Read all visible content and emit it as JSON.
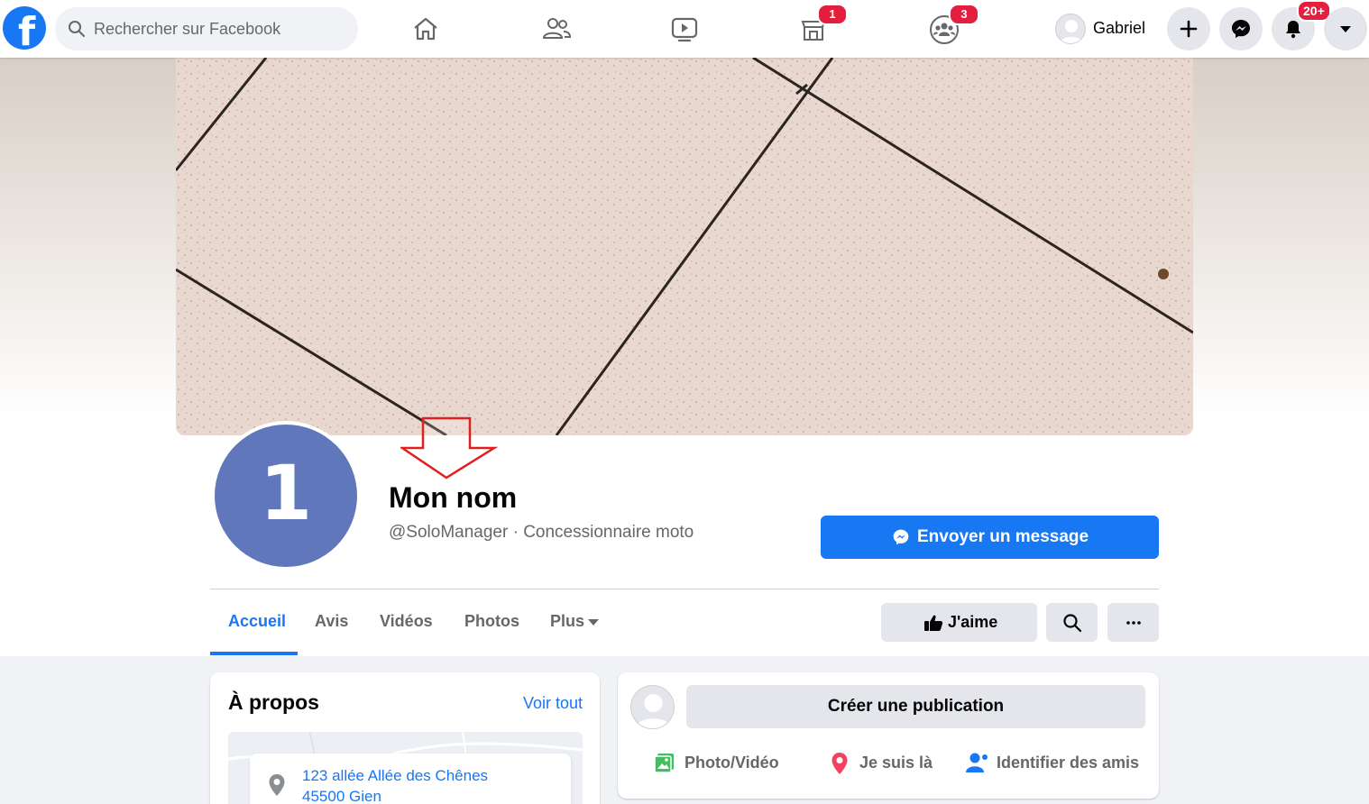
{
  "topbar": {
    "logo": "f",
    "search_placeholder": "Rechercher sur Facebook",
    "nav": [
      {
        "name": "home-icon"
      },
      {
        "name": "friends-icon"
      },
      {
        "name": "watch-icon"
      },
      {
        "name": "marketplace-icon",
        "badge": "1"
      },
      {
        "name": "groups-icon",
        "badge": "3"
      }
    ],
    "user_name": "Gabriel",
    "notifications_badge": "20+"
  },
  "page": {
    "avatar_text": "1",
    "title": "Mon nom",
    "subtitle": "@SoloManager · Concessionnaire moto",
    "message_button": "Envoyer un message"
  },
  "tabs": [
    {
      "label": "Accueil",
      "active": true
    },
    {
      "label": "Avis"
    },
    {
      "label": "Vidéos"
    },
    {
      "label": "Photos"
    },
    {
      "label": "Plus"
    }
  ],
  "actions": {
    "like_label": "J'aime"
  },
  "about": {
    "title": "À propos",
    "see_all": "Voir tout",
    "address_line1": "123 allée Allée des Chênes",
    "address_line2": "45500 Gien"
  },
  "composer": {
    "create_label": "Créer une publication",
    "photo_video": "Photo/Vidéo",
    "checkin": "Je suis là",
    "tag_friends": "Identifier des amis"
  },
  "colors": {
    "accent": "#1877f2",
    "badge": "#e41e3f",
    "avatar_bg": "#6077bb",
    "annotation_arrow": "#e02020"
  }
}
